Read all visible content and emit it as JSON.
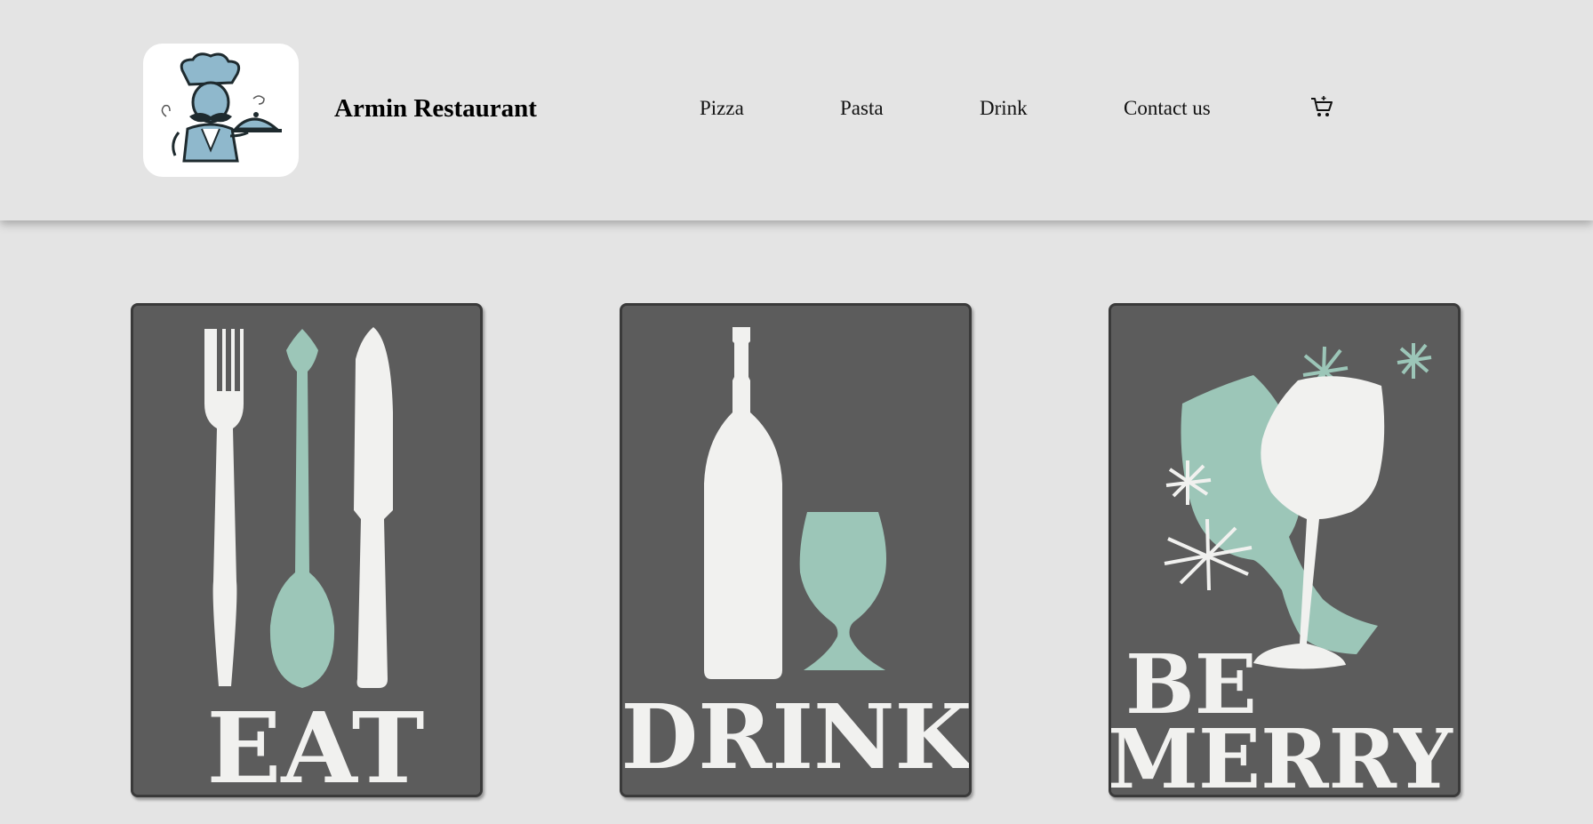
{
  "header": {
    "brand": "Armin Restaurant",
    "nav": [
      "Pizza",
      "Pasta",
      "Drink",
      "Contact us"
    ],
    "cart_icon": "cart-icon"
  },
  "cards": [
    {
      "word": "EAT",
      "icon": "cutlery-illustration"
    },
    {
      "word": "DRINK",
      "icon": "bottle-glass-illustration"
    },
    {
      "word_line1": "BE",
      "word_line2": "MERRY",
      "icon": "toasting-glasses-illustration"
    }
  ],
  "colors": {
    "page_bg": "#e4e4e4",
    "poster_bg": "#5c5c5c",
    "poster_white": "#f1f1ef",
    "poster_mint": "#9cc6b8",
    "logo_blue": "#8fb8cc"
  }
}
